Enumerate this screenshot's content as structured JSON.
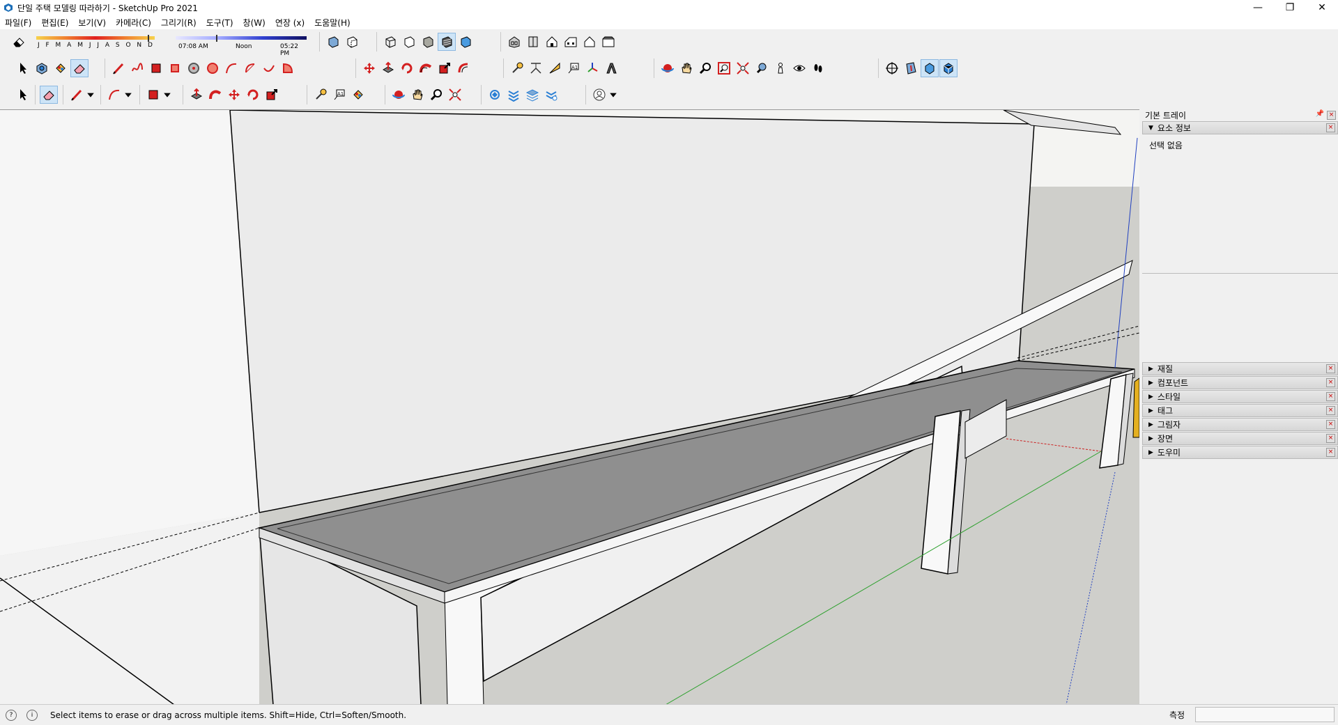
{
  "window": {
    "title": "단일 주택 모델링 따라하기 - SketchUp Pro 2021",
    "minimize_glyph": "—",
    "restore_glyph": "❐",
    "close_glyph": "✕"
  },
  "menu": [
    "파일(F)",
    "편집(E)",
    "보기(V)",
    "카메라(C)",
    "그리기(R)",
    "도구(T)",
    "창(W)",
    "연장 (x)",
    "도움말(H)"
  ],
  "shadow_settings": {
    "months": "J F M A M J J A S O N D",
    "time_start": "07:08 AM",
    "time_mid": "Noon",
    "time_end": "05:22 PM"
  },
  "tray": {
    "title": "기본 트레이",
    "entity_panel_title": "요소 정보",
    "entity_status": "선택 없음",
    "panels": [
      "재질",
      "컴포넌트",
      "스타일",
      "태그",
      "그림자",
      "장면",
      "도우미"
    ]
  },
  "status": {
    "message": "Select items to erase or drag across multiple items. Shift=Hide, Ctrl=Soften/Smooth.",
    "measure_label": "측정",
    "measure_value": ""
  },
  "active_tool": "eraser-tool",
  "colors": {
    "tool_red": "#d32020",
    "tool_blue": "#2a7fd4",
    "axis_red": "#cc2020",
    "axis_green": "#2ca02c",
    "axis_blue": "#2040c0"
  }
}
